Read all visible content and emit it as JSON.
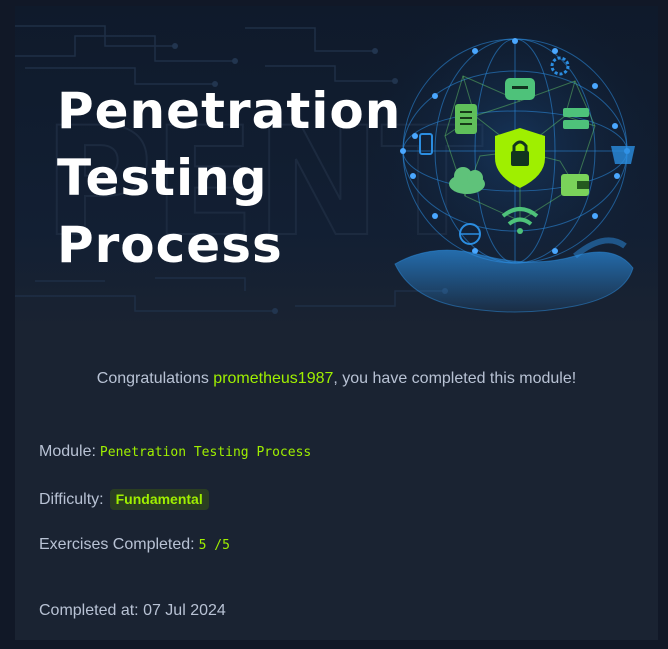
{
  "banner": {
    "title": "Penetration Testing Process",
    "watermark": "PENT",
    "graphic_icons": [
      "lock-shield-icon",
      "chat-icon",
      "document-icon",
      "server-icon",
      "cloud-icon",
      "wifi-icon",
      "wallet-icon",
      "basket-icon",
      "globe-icon",
      "tablet-icon",
      "gear-icon",
      "hand-icon"
    ],
    "colors": {
      "background": "#0f1a2b",
      "globe_lines": "#2b8de0",
      "accent_green": "#9fef00"
    }
  },
  "congrats": {
    "prefix": "Congratulations ",
    "username": "prometheus1987",
    "suffix": ", you have completed this module!"
  },
  "details": {
    "module_label": "Module:",
    "module_value": "Penetration Testing Process",
    "difficulty_label": "Difficulty:",
    "difficulty_value": "Fundamental",
    "exercises_label": "Exercises Completed:",
    "exercises_value": "5 /5",
    "completed_label": "Completed at:",
    "completed_value": "07 Jul 2024"
  },
  "colors": {
    "page_bg": "#111827",
    "card_bg": "#1a2332",
    "text": "#b8c2d4",
    "accent": "#9fef00",
    "badge_bg": "#2a3e22"
  }
}
